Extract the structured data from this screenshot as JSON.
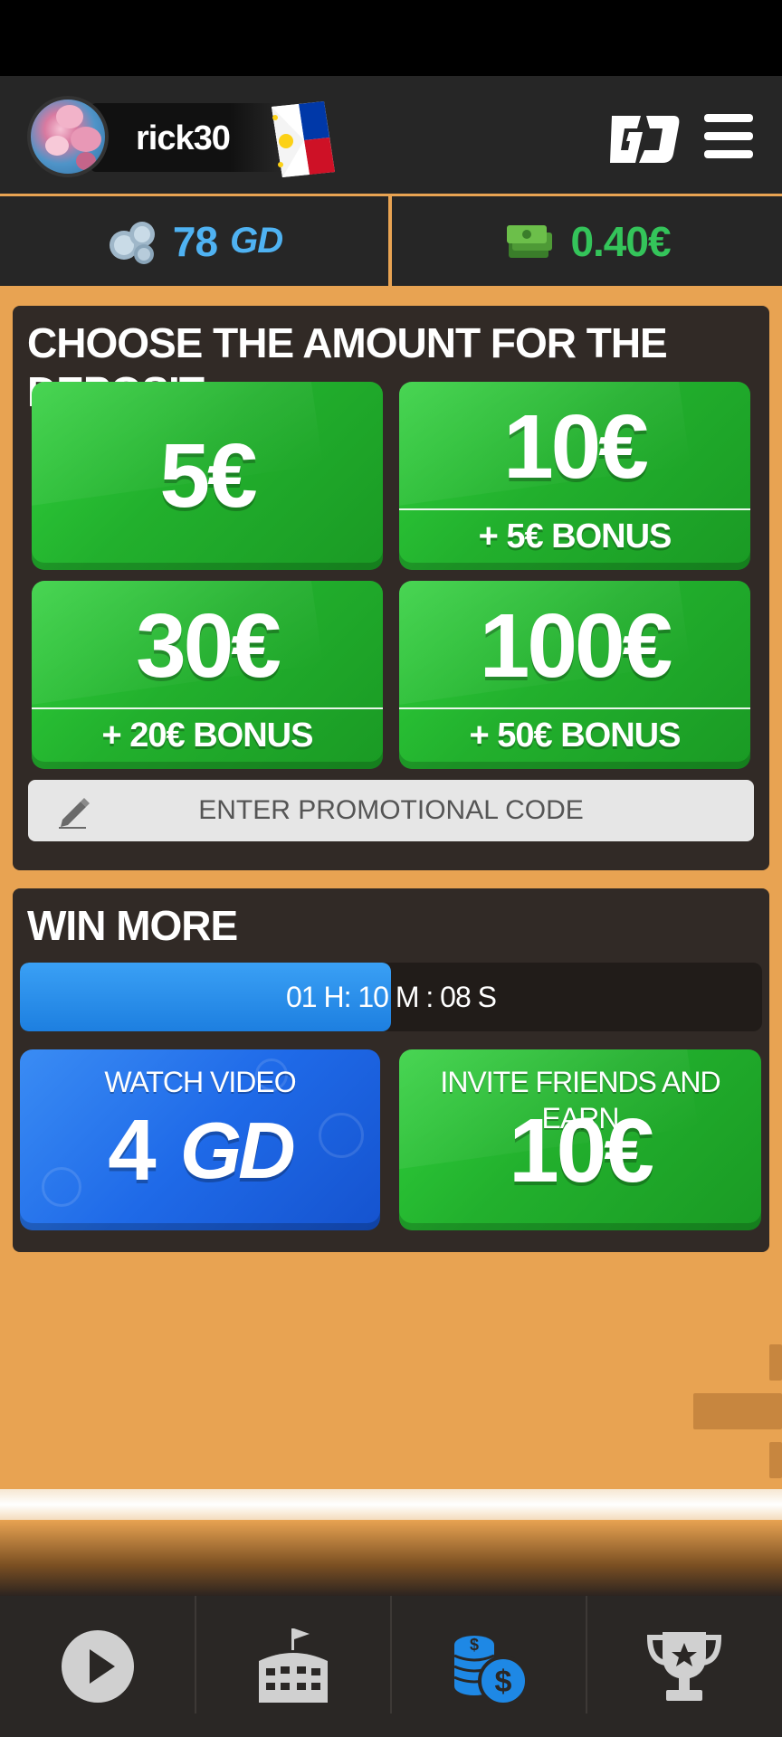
{
  "user": {
    "username": "rick30"
  },
  "header": {
    "logo_text": "GD"
  },
  "balance": {
    "coins_value": "78",
    "coins_unit": "GD",
    "cash_value": "0.40€"
  },
  "deposit": {
    "title": "CHOOSE THE AMOUNT FOR THE DEPOSIT",
    "options": [
      {
        "amount": "5€",
        "bonus": ""
      },
      {
        "amount": "10€",
        "bonus": "+ 5€ BONUS"
      },
      {
        "amount": "30€",
        "bonus": "+ 20€ BONUS"
      },
      {
        "amount": "100€",
        "bonus": "+ 50€ BONUS"
      }
    ],
    "promo_placeholder": "ENTER PROMOTIONAL CODE"
  },
  "win_more": {
    "title": "WIN MORE",
    "timer": "01 H: 10 M : 08 S",
    "timer_progress": 0.5,
    "watch_video": {
      "label": "WATCH VIDEO",
      "value": "4",
      "unit": "GD"
    },
    "invite": {
      "label": "INVITE FRIENDS AND EARN",
      "value": "10€"
    }
  },
  "colors": {
    "background": "#e8a352",
    "coins": "#4fb2f2",
    "cash": "#34c45a",
    "active_nav": "#1e88e5"
  },
  "bottom_nav": [
    {
      "icon": "play-icon",
      "active": false
    },
    {
      "icon": "stadium-icon",
      "active": false
    },
    {
      "icon": "coins-icon",
      "active": true
    },
    {
      "icon": "trophy-icon",
      "active": false
    }
  ]
}
